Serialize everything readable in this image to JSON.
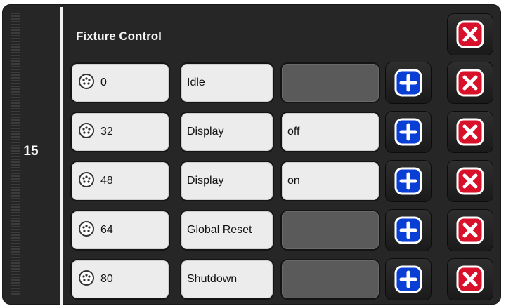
{
  "panel": {
    "index": "15",
    "title": "Fixture Control",
    "colors": {
      "add": "#0a3fd6",
      "close": "#d8102a"
    },
    "rows": [
      {
        "value": "0",
        "label": "Idle",
        "state": ""
      },
      {
        "value": "32",
        "label": "Display",
        "state": "off"
      },
      {
        "value": "48",
        "label": "Display",
        "state": "on"
      },
      {
        "value": "64",
        "label": "Global Reset",
        "state": ""
      },
      {
        "value": "80",
        "label": "Shutdown",
        "state": ""
      }
    ]
  }
}
